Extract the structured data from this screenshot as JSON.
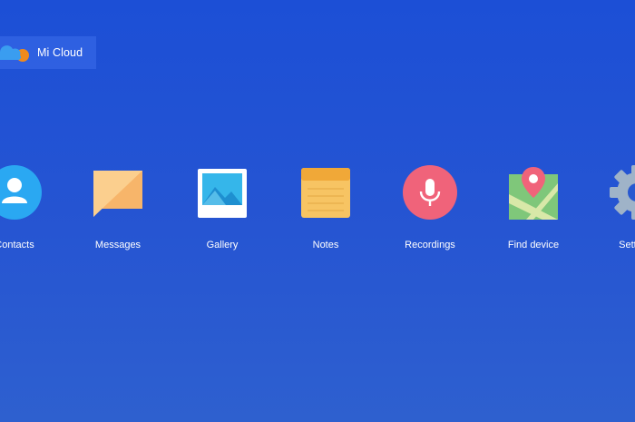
{
  "brand": {
    "title": "Mi Cloud",
    "logo_icon": "cloud-logo-icon",
    "colors": {
      "cloud": "#3a9df0",
      "accent": "#f08a1c"
    }
  },
  "apps": [
    {
      "key": "contacts",
      "label": "Contacts",
      "icon": "contacts-icon",
      "color": "#2aa8f2"
    },
    {
      "key": "messages",
      "label": "Messages",
      "icon": "messages-icon",
      "color": "#f7b56a"
    },
    {
      "key": "gallery",
      "label": "Gallery",
      "icon": "gallery-icon",
      "color": "#35b6ea"
    },
    {
      "key": "notes",
      "label": "Notes",
      "icon": "notes-icon",
      "color": "#f7c463"
    },
    {
      "key": "recordings",
      "label": "Recordings",
      "icon": "microphone-icon",
      "color": "#f0637a"
    },
    {
      "key": "find",
      "label": "Find device",
      "icon": "map-pin-icon",
      "color": "#7fc77a"
    },
    {
      "key": "settings",
      "label": "Settings",
      "icon": "gear-icon",
      "color": "#9fb3c8"
    }
  ],
  "background": {
    "top": "#1c4fd6",
    "bottom": "#2e60cf"
  }
}
